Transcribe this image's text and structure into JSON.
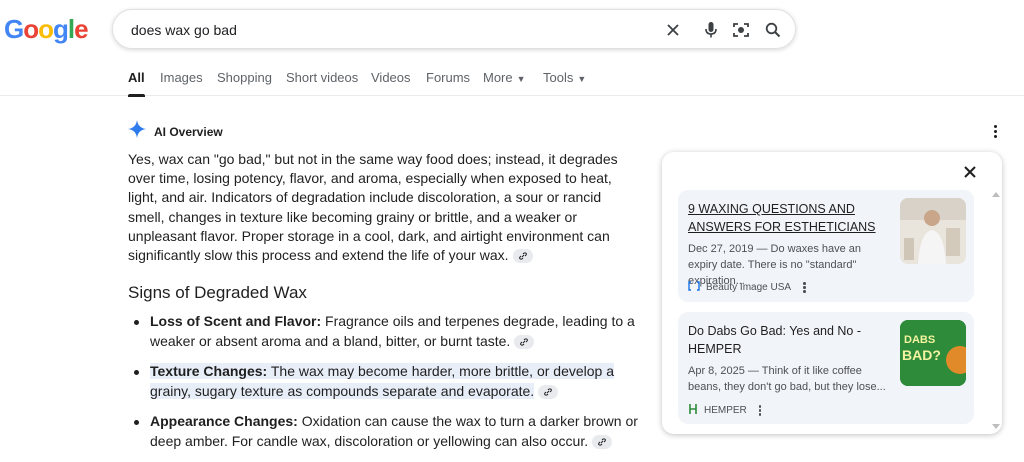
{
  "logo": {
    "letters": [
      "G",
      "o",
      "o",
      "g",
      "l",
      "e"
    ]
  },
  "search": {
    "query": "does wax go bad"
  },
  "tabs": [
    {
      "label": "All",
      "active": true
    },
    {
      "label": "Images"
    },
    {
      "label": "Shopping"
    },
    {
      "label": "Short videos"
    },
    {
      "label": "Videos"
    },
    {
      "label": "Forums"
    },
    {
      "label": "More"
    },
    {
      "label": "Tools"
    }
  ],
  "ai_overview": {
    "title": "AI Overview",
    "paragraph": "Yes, wax can \"go bad,\" but not in the same way food does; instead, it degrades over time, losing potency, flavor, and aroma, especially when exposed to heat, light, and air. Indicators of degradation include discoloration, a sour or rancid smell, changes in texture like becoming grainy or brittle, and a weaker or unpleasant flavor. Proper storage in a cool, dark, and airtight environment can significantly slow this process and extend the life of your wax.",
    "heading": "Signs of Degraded Wax",
    "bullets": [
      {
        "term": "Loss of Scent and Flavor:",
        "text": " Fragrance oils and terpenes degrade, leading to a weaker or absent aroma and a bland, bitter, or burnt taste."
      },
      {
        "term": "Texture Changes:",
        "text": " The wax may become harder, more brittle, or develop a grainy, sugary texture as compounds separate and evaporate."
      },
      {
        "term": "Appearance Changes:",
        "text": " Oxidation can cause the wax to turn a darker brown or deep amber. For candle wax, discoloration or yellowing can also occur."
      }
    ]
  },
  "sources": [
    {
      "title": "9 WAXING QUESTIONS AND ANSWERS FOR ESTHETICIANS",
      "snippet": "Dec 27, 2019 — Do waxes have an expiry date. There is no \"standard\" expiration...",
      "source": "Beauty Image USA"
    },
    {
      "title": "Do Dabs Go Bad: Yes and No - HEMPER",
      "snippet": "Apr 8, 2025 — Think of it like coffee beans, they don't go bad, but they lose...",
      "source": "HEMPER",
      "thumb_text": [
        "DABS",
        "BAD?"
      ]
    }
  ],
  "colors": {
    "accent_blue": "#4285F4",
    "panel_card": "#f1f4f9",
    "hemper_green": "#2e8b3a"
  }
}
